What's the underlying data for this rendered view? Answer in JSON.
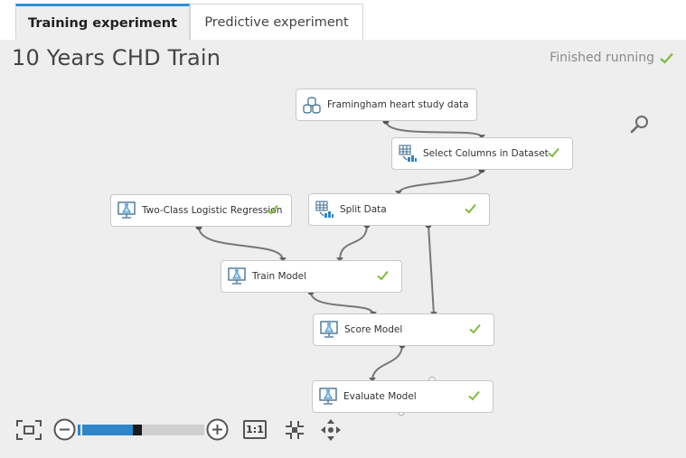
{
  "tabs": [
    {
      "label": "Training experiment",
      "active": true
    },
    {
      "label": "Predictive experiment",
      "active": false
    }
  ],
  "experiment": {
    "title": "10 Years CHD Train",
    "status": "Finished running"
  },
  "nodes": {
    "dataset": {
      "label": "Framingham heart study data",
      "icon": "dataset-icon"
    },
    "select_columns": {
      "label": "Select Columns in Dataset",
      "icon": "table-transform-icon",
      "finished": true
    },
    "logistic_regression": {
      "label": "Two-Class Logistic Regression",
      "icon": "model-screen-icon",
      "finished": true
    },
    "split_data": {
      "label": "Split Data",
      "icon": "table-transform-icon",
      "finished": true
    },
    "train_model": {
      "label": "Train Model",
      "icon": "model-screen-icon",
      "finished": true
    },
    "score_model": {
      "label": "Score Model",
      "icon": "model-screen-icon",
      "finished": true
    },
    "evaluate_model": {
      "label": "Evaluate Model",
      "icon": "model-screen-icon",
      "finished": true
    }
  },
  "toolbar": {
    "actual_size_label": "1:1",
    "zoom_level": 0.45
  },
  "colors": {
    "accent": "#2b8fd6",
    "success": "#7dbb3a",
    "canvas": "#eeeeee"
  }
}
